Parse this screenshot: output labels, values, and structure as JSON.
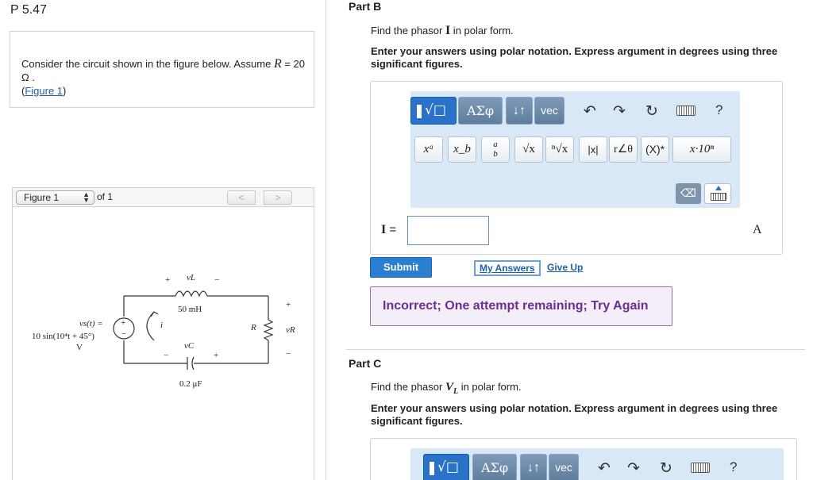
{
  "problem": {
    "title": "P 5.47",
    "statement_pre": "Consider the circuit shown in the figure below. Assume ",
    "statement_var": "R",
    "statement_post": " = 20 Ω .",
    "figure_link_open": "(",
    "figure_link": "Figure 1",
    "figure_link_close": ")"
  },
  "figure_nav": {
    "selected": "Figure 1",
    "of_label": "of 1",
    "prev": "<",
    "next": ">"
  },
  "circuit": {
    "vl_label": "vL",
    "vl_plus": "+",
    "vl_minus": "−",
    "inductor_value": "50 mH",
    "source_label_1": "vs(t) =",
    "source_label_2": "10 sin(10⁴t + 45°)",
    "source_label_3": "V",
    "current_label": "i",
    "r_label": "R",
    "vr_label": "vR",
    "vr_plus": "+",
    "vr_minus": "−",
    "vc_label": "vC",
    "vc_minus": "−",
    "vc_plus": "+",
    "capacitor_value": "0.2 μF",
    "source_plus": "+",
    "source_minus": "−"
  },
  "part_b": {
    "title": "Part B",
    "question_pre": "Find the phasor ",
    "question_var": "I",
    "question_post": " in polar form.",
    "instructions": "Enter your answers using polar notation. Express argument in degrees using three significant figures.",
    "toolbar": {
      "templates": "√□",
      "greek": "ΑΣφ",
      "arrows": "↓↑",
      "vec": "vec",
      "undo": "↶",
      "redo": "↷",
      "reset": "↻",
      "help": "?",
      "power": "xᵃ",
      "subscript": "x_b",
      "fraction_num": "a",
      "fraction_den": "b",
      "sqrt": "√x",
      "nroot": "ⁿ√x",
      "abs": "|x|",
      "polar": "r∠θ",
      "conjugate": "(X)*",
      "sci": "x·10ⁿ",
      "backspace": "⌫"
    },
    "answer_label": "I",
    "answer_eq": " =",
    "answer_value": "",
    "unit": "A",
    "submit": "Submit",
    "my_answers": "My Answers",
    "give_up": "Give Up",
    "feedback": "Incorrect; One attempt remaining; Try Again"
  },
  "part_c": {
    "title": "Part C",
    "question_pre": "Find the phasor ",
    "question_var": "V",
    "question_sub": "L",
    "question_post": " in polar form.",
    "instructions": "Enter your answers using polar notation. Express argument in degrees using three significant figures.",
    "toolbar": {
      "templates": "√□",
      "greek": "ΑΣφ",
      "arrows": "↓↑",
      "vec": "vec",
      "undo": "↶",
      "redo": "↷",
      "reset": "↻",
      "help": "?"
    }
  },
  "colors": {
    "accent_blue": "#2a72c8",
    "feedback_purple": "#6b2f92",
    "toolbar_bg": "#d9e8f6"
  }
}
